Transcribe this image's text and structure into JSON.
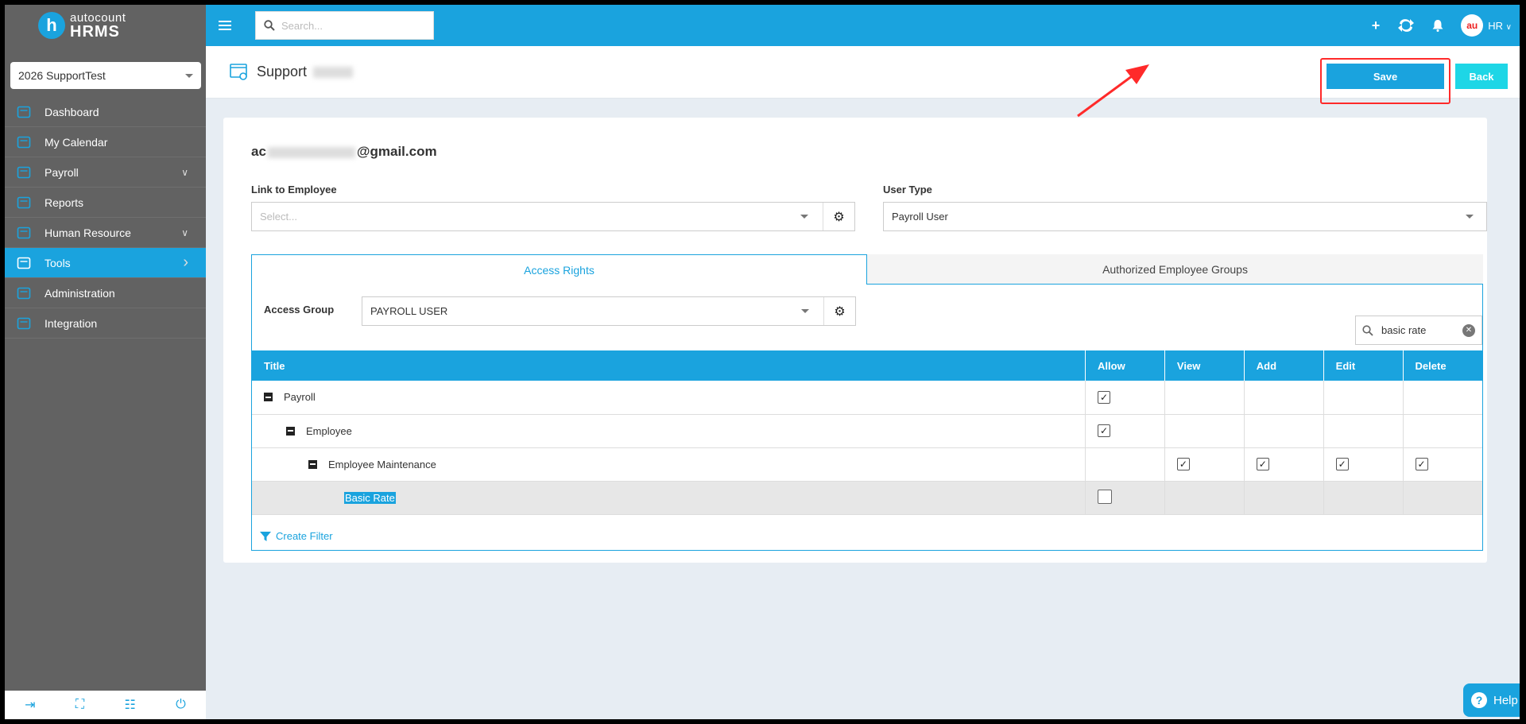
{
  "brand": {
    "line1": "autocount",
    "line2": "HRMS",
    "logo_letter": "h"
  },
  "company_selector": {
    "value": "2026 SupportTest"
  },
  "sidebar": {
    "items": [
      {
        "label": "Dashboard",
        "icon": "dashboard-icon"
      },
      {
        "label": "My Calendar",
        "icon": "calendar-icon"
      },
      {
        "label": "Payroll",
        "icon": "payroll-icon",
        "chevron": "down"
      },
      {
        "label": "Reports",
        "icon": "reports-icon"
      },
      {
        "label": "Human Resource",
        "icon": "human-resource-icon",
        "chevron": "down"
      },
      {
        "label": "Tools",
        "icon": "tools-icon",
        "chevron": "right",
        "active": true
      },
      {
        "label": "Administration",
        "icon": "administration-icon"
      },
      {
        "label": "Integration",
        "icon": "integration-icon"
      }
    ]
  },
  "topbar": {
    "search_placeholder": "Search...",
    "user_label": "HR"
  },
  "page": {
    "title": "Support",
    "save_label": "Save",
    "back_label": "Back"
  },
  "form": {
    "email_prefix": "ac",
    "email_suffix": "@gmail.com",
    "link_label": "Link to Employee",
    "link_placeholder": "Select...",
    "user_type_label": "User Type",
    "user_type_value": "Payroll User"
  },
  "tabs": [
    {
      "label": "Access Rights",
      "active": true
    },
    {
      "label": "Authorized Employee Groups",
      "active": false
    }
  ],
  "access": {
    "group_label": "Access Group",
    "group_value": "PAYROLL USER",
    "filter_value": "basic rate",
    "create_filter_label": "Create Filter",
    "columns": [
      "Title",
      "Allow",
      "View",
      "Add",
      "Edit",
      "Delete"
    ]
  },
  "rows": [
    {
      "title": "Payroll",
      "level": 0,
      "allow": true,
      "view": null,
      "add": null,
      "edit": null,
      "delete": null
    },
    {
      "title": "Employee",
      "level": 1,
      "allow": true,
      "view": null,
      "add": null,
      "edit": null,
      "delete": null
    },
    {
      "title": "Employee Maintenance",
      "level": 2,
      "allow": null,
      "view": true,
      "add": true,
      "edit": true,
      "delete": true
    },
    {
      "title": "Basic Rate",
      "level": 3,
      "allow": false,
      "view": null,
      "add": null,
      "edit": null,
      "delete": null
    }
  ],
  "help": {
    "label": "Help"
  },
  "colors": {
    "accent": "#1aa3de",
    "sidebar": "#626262",
    "highlight": "#ff2a2a",
    "back": "#1ed6e6"
  }
}
